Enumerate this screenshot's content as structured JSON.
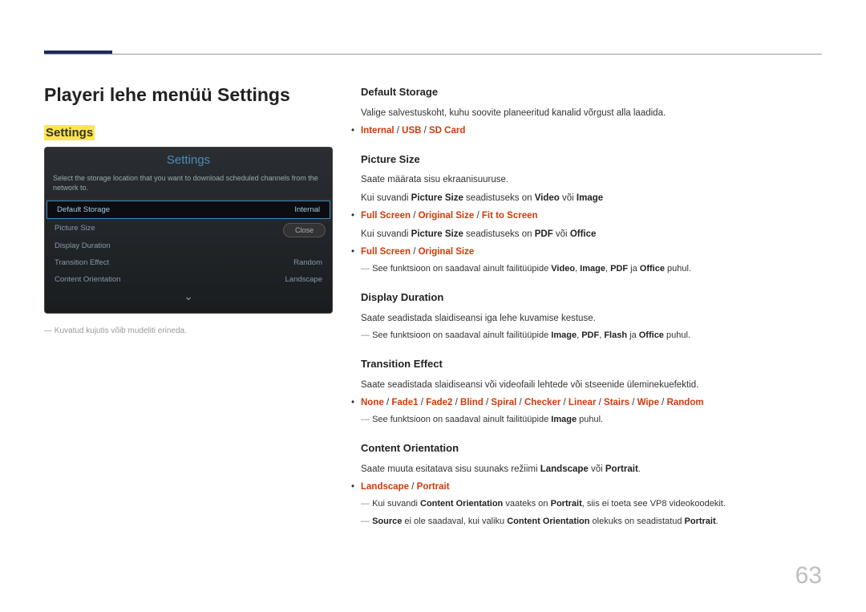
{
  "header": {
    "title": "Playeri lehe menüü Settings",
    "highlighted": "Settings"
  },
  "panel": {
    "title": "Settings",
    "desc": "Select the storage location that you want to download scheduled channels from the network to.",
    "rows": [
      {
        "label": "Default Storage",
        "value": "Internal"
      },
      {
        "label": "Picture Size",
        "value": ""
      },
      {
        "label": "Display Duration",
        "value": ""
      },
      {
        "label": "Transition Effect",
        "value": "Random"
      },
      {
        "label": "Content Orientation",
        "value": "Landscape"
      }
    ],
    "close": "Close",
    "footnote": "Kuvatud kujutis võib mudeliti erineda."
  },
  "sections": {
    "defaultStorage": {
      "title": "Default Storage",
      "desc": "Valige salvestuskoht, kuhu soovite planeeritud kanalid võrgust alla laadida.",
      "opts": {
        "a": "Internal",
        "b": "USB",
        "c": "SD Card"
      }
    },
    "pictureSize": {
      "title": "Picture Size",
      "desc1": "Saate määrata sisu ekraanisuuruse.",
      "line2_pre": "Kui suvandi ",
      "line2_bold": "Picture Size",
      "line2_mid": " seadistuseks on ",
      "line2_v1": "Video",
      "line2_or": " või ",
      "line2_v2": "Image",
      "opts1": {
        "a": "Full Screen",
        "b": "Original Size",
        "c": "Fit to Screen"
      },
      "line3_pre": "Kui suvandi ",
      "line3_bold": "Picture Size",
      "line3_mid": " seadistuseks on ",
      "line3_v1": "PDF",
      "line3_or": " või ",
      "line3_v2": "Office",
      "opts2": {
        "a": "Full Screen",
        "b": "Original Size"
      },
      "note_pre": "See funktsioon on saadaval ainult failitüüpide ",
      "note_v1": "Video",
      "note_v2": "Image",
      "note_v3": "PDF",
      "note_ja": " ja ",
      "note_v4": "Office",
      "note_suf": " puhul."
    },
    "displayDuration": {
      "title": "Display Duration",
      "desc": "Saate seadistada slaidiseansi iga lehe kuvamise kestuse.",
      "note_pre": "See funktsioon on saadaval ainult failitüüpide ",
      "note_v1": "Image",
      "note_v2": "PDF",
      "note_v3": "Flash",
      "note_ja": " ja ",
      "note_v4": "Office",
      "note_suf": " puhul."
    },
    "transitionEffect": {
      "title": "Transition Effect",
      "desc": "Saate seadistada slaidiseansi või videofaili lehtede või stseenide üleminekuefektid.",
      "opts": {
        "a": "None",
        "b": "Fade1",
        "c": "Fade2",
        "d": "Blind",
        "e": "Spiral",
        "f": "Checker",
        "g": "Linear",
        "h": "Stairs",
        "i": "Wipe",
        "j": "Random"
      },
      "note_pre": "See funktsioon on saadaval ainult failitüüpide ",
      "note_v1": "Image",
      "note_suf": " puhul."
    },
    "contentOrientation": {
      "title": "Content Orientation",
      "desc_pre": "Saate muuta esitatava sisu suunaks režiimi ",
      "desc_v1": "Landscape",
      "desc_or": " või ",
      "desc_v2": "Portrait",
      "desc_suf": ".",
      "opts": {
        "a": "Landscape",
        "b": "Portrait"
      },
      "note1_pre": "Kui suvandi ",
      "note1_b1": "Content Orientation",
      "note1_mid": " vaateks on ",
      "note1_b2": "Portrait",
      "note1_suf": ", siis ei toeta see VP8 videokoodekit.",
      "note2_b1": "Source",
      "note2_mid": " ei ole saadaval, kui valiku ",
      "note2_b2": "Content Orientation",
      "note2_mid2": " olekuks on seadistatud ",
      "note2_b3": "Portrait",
      "note2_suf": "."
    }
  },
  "pageNumber": "63"
}
